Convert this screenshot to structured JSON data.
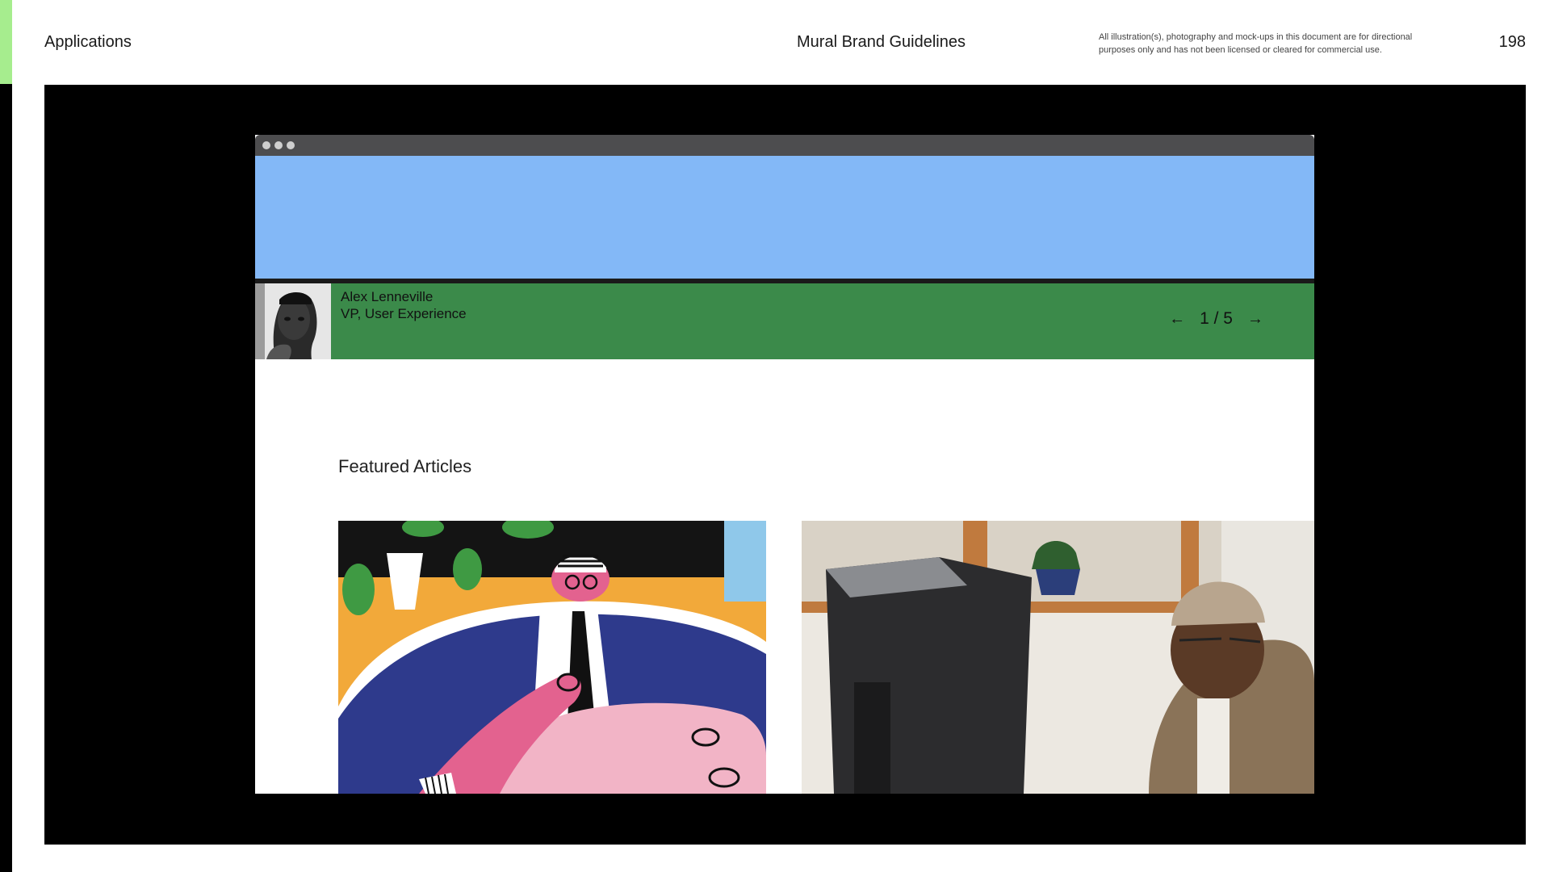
{
  "header": {
    "section": "Applications",
    "title": "Mural Brand Guidelines",
    "disclaimer": "All illustration(s), photography and mock-ups in this document are for directional purposes only and has not been licensed or cleared for commercial use.",
    "page_number": "198"
  },
  "mockup": {
    "profile": {
      "name": "Alex Lenneville",
      "role": "VP, User Experience"
    },
    "pager": {
      "prev_icon": "arrow-left-icon",
      "label": "1 / 5",
      "next_icon": "arrow-right-icon"
    },
    "section_heading": "Featured Articles",
    "colors": {
      "hero": "#83b8f7",
      "profile_band": "#3b8a4a",
      "accent": "#a6ed8e"
    }
  }
}
